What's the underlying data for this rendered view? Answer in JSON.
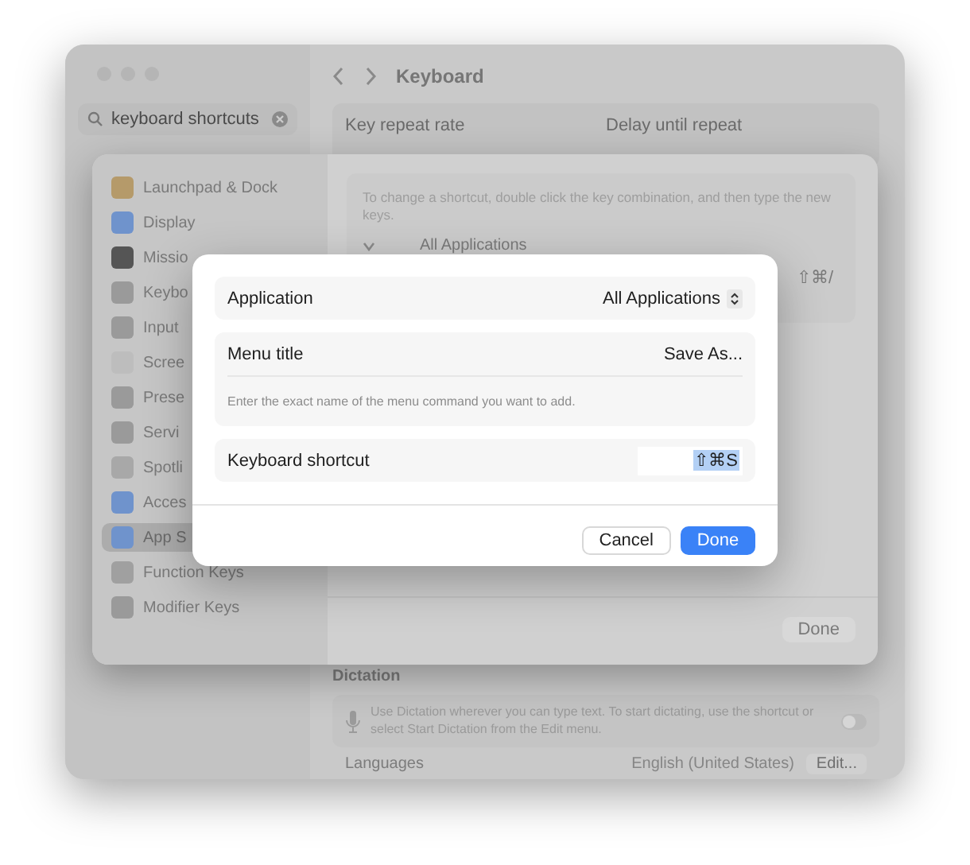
{
  "window": {
    "title": "Keyboard",
    "search": {
      "value": "keyboard shortcuts"
    },
    "repeat_labels": [
      "Key repeat rate",
      "Delay until repeat"
    ],
    "dictation": {
      "heading": "Dictation",
      "description": "Use Dictation wherever you can type text. To start dictating, use the shortcut or select Start Dictation from the Edit menu.",
      "on": false
    },
    "languages": {
      "label": "Languages",
      "value": "English (United States)",
      "button": "Edit..."
    }
  },
  "sheet": {
    "sidebar": [
      {
        "label": "Launchpad & Dock",
        "color": "#b59a6a",
        "selected": false
      },
      {
        "label": "Display",
        "color": "#6f93cc",
        "selected": false
      },
      {
        "label": "Missio",
        "color": "#555555",
        "selected": false
      },
      {
        "label": "Keybo",
        "color": "#9a9a9a",
        "selected": false
      },
      {
        "label": "Input",
        "color": "#9a9a9a",
        "selected": false
      },
      {
        "label": "Scree",
        "color": "#bdbdbd",
        "selected": false
      },
      {
        "label": "Prese",
        "color": "#9a9a9a",
        "selected": false
      },
      {
        "label": "Servi",
        "color": "#9a9a9a",
        "selected": false
      },
      {
        "label": "Spotli",
        "color": "#a8a8a8",
        "selected": false
      },
      {
        "label": "Acces",
        "color": "#6f93cc",
        "selected": false
      },
      {
        "label": "App S",
        "color": "#6f93cc",
        "selected": true
      },
      {
        "label": "Function Keys",
        "color": "#a0a0a0",
        "selected": false
      },
      {
        "label": "Modifier Keys",
        "color": "#9a9a9a",
        "selected": false
      }
    ],
    "info": "To change a shortcut, double click the key combination, and then type the new keys.",
    "group": {
      "label": "All Applications",
      "expanded": true
    },
    "shortcut": "⇧⌘/",
    "done": "Done"
  },
  "dialog": {
    "application": {
      "label": "Application",
      "value": "All Applications"
    },
    "menu_title": {
      "label": "Menu title",
      "value": "Save As...",
      "hint": "Enter the exact name of the menu command you want to add."
    },
    "shortcut": {
      "label": "Keyboard shortcut",
      "value": "⇧⌘S",
      "selected": true
    },
    "buttons": [
      {
        "label": "Cancel",
        "kind": "secondary"
      },
      {
        "label": "Done",
        "kind": "primary"
      }
    ]
  }
}
